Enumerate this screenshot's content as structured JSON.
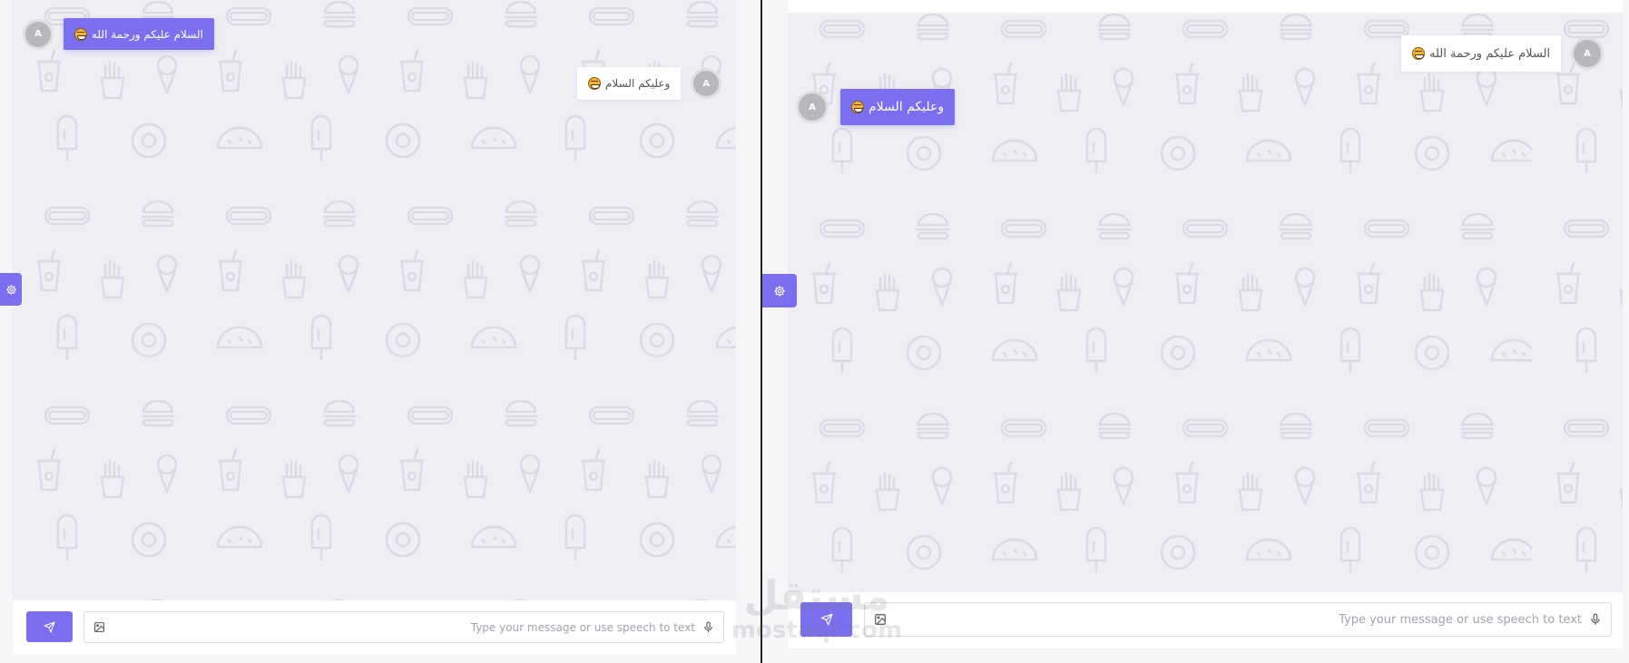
{
  "left_pane": {
    "messages": [
      {
        "avatar": "A",
        "text": "السلام عليكم ورحمة الله",
        "type": "sent"
      },
      {
        "avatar": "A",
        "text": "وعليكم السلام",
        "type": "received"
      }
    ],
    "composer": {
      "placeholder": "Type your message or use speech to text"
    }
  },
  "right_pane": {
    "messages": [
      {
        "avatar": "A",
        "text": "السلام عليكم ورحمة الله",
        "type": "received"
      },
      {
        "avatar": "A",
        "text": "وعليكم السلام",
        "type": "sent"
      }
    ],
    "composer": {
      "placeholder": "Type your message or use speech to text"
    }
  },
  "watermark": {
    "arabic": "مستقل",
    "latin": "mostaql.com"
  },
  "colors": {
    "accent": "#7b6ff0",
    "chat_background": "#efeef4",
    "pattern": "#dcdbe4"
  },
  "icons": [
    "settings-gear-icon",
    "send-icon",
    "image-attach-icon",
    "microphone-icon",
    "grinning-emoji-icon"
  ]
}
